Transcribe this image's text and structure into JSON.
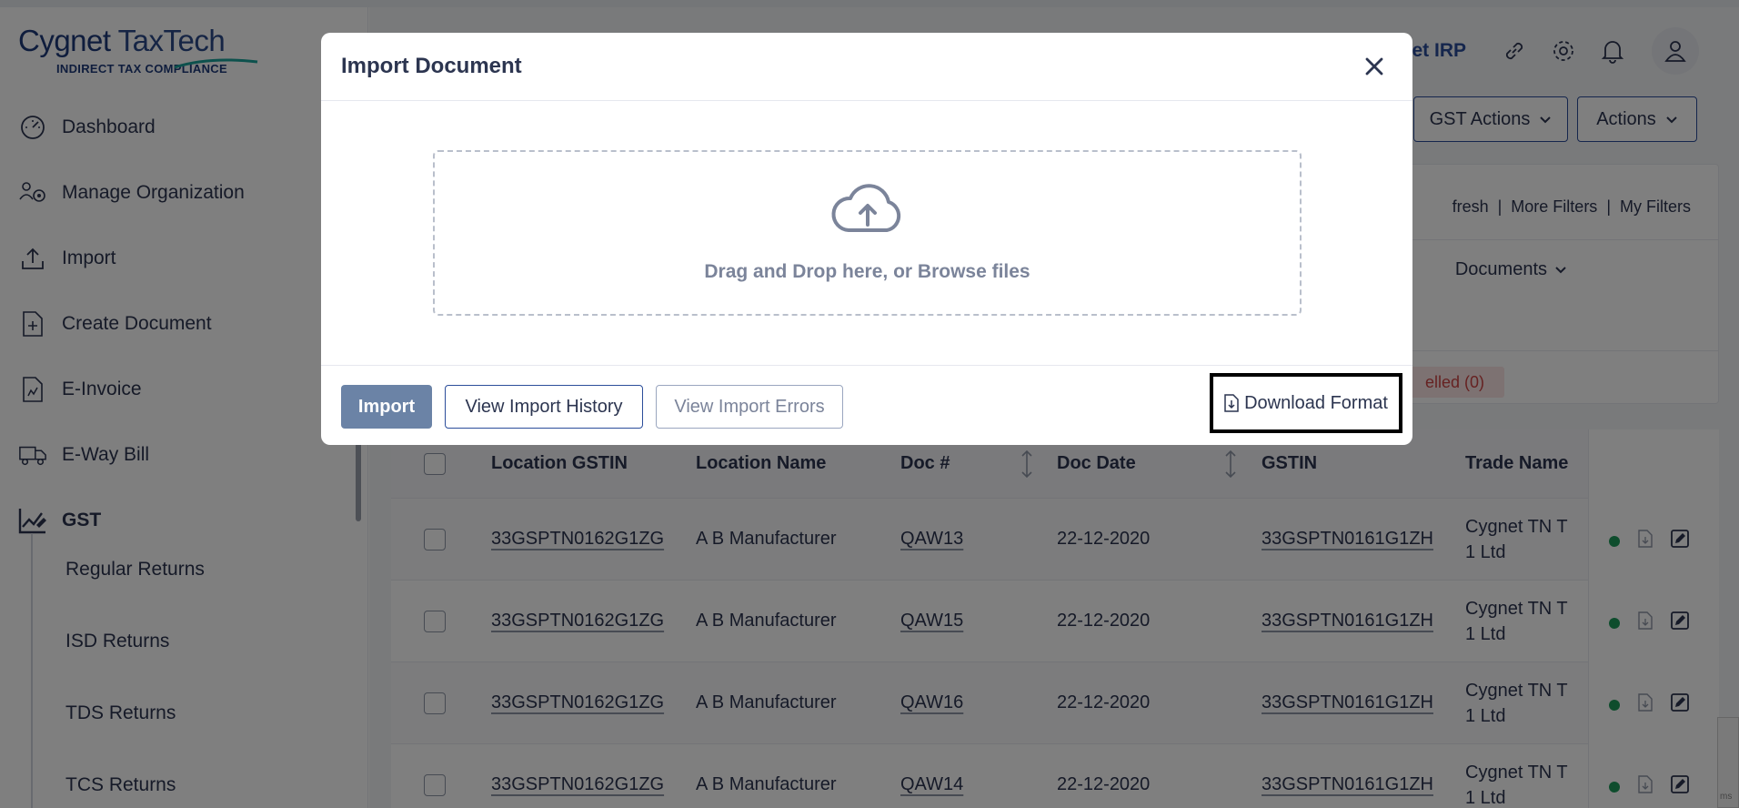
{
  "brand": {
    "logo_main": "Cygnet",
    "logo_tech": "TaxTech",
    "logo_sub": "INDIRECT TAX COMPLIANCE"
  },
  "sidebar": {
    "items": [
      {
        "label": "Dashboard",
        "icon": "gauge-icon"
      },
      {
        "label": "Manage Organization",
        "icon": "organization-icon"
      },
      {
        "label": "Import",
        "icon": "upload-icon"
      },
      {
        "label": "Create Document",
        "icon": "add-document-icon"
      },
      {
        "label": "E-Invoice",
        "icon": "invoice-icon"
      },
      {
        "label": "E-Way Bill",
        "icon": "truck-icon"
      },
      {
        "label": "GST",
        "icon": "chart-pen-icon"
      }
    ],
    "subitems": [
      "Regular Returns",
      "ISD Returns",
      "TDS Returns",
      "TCS Returns"
    ]
  },
  "header": {
    "irp_text": "net IRP"
  },
  "toolbar": {
    "gst_actions": "GST Actions",
    "actions": "Actions"
  },
  "filters": {
    "refresh": "fresh",
    "more_filters": "More Filters",
    "my_filters": "My Filters",
    "documents": "Documents",
    "cancelled": "elled (0)"
  },
  "table": {
    "headers": {
      "location_gstin": "Location GSTIN",
      "location_name": "Location Name",
      "doc_no": "Doc #",
      "doc_date": "Doc Date",
      "gstin": "GSTIN",
      "trade_name": "Trade Name"
    },
    "rows": [
      {
        "location_gstin": "33GSPTN0162G1ZG",
        "location_name": "A B Manufacturer",
        "doc_no": "QAW13",
        "doc_date": "22-12-2020",
        "gstin": "33GSPTN0161G1ZH",
        "trade_line1": "Cygnet TN T",
        "trade_line2": "1 Ltd"
      },
      {
        "location_gstin": "33GSPTN0162G1ZG",
        "location_name": "A B Manufacturer",
        "doc_no": "QAW15",
        "doc_date": "22-12-2020",
        "gstin": "33GSPTN0161G1ZH",
        "trade_line1": "Cygnet TN T",
        "trade_line2": "1 Ltd"
      },
      {
        "location_gstin": "33GSPTN0162G1ZG",
        "location_name": "A B Manufacturer",
        "doc_no": "QAW16",
        "doc_date": "22-12-2020",
        "gstin": "33GSPTN0161G1ZH",
        "trade_line1": "Cygnet TN T",
        "trade_line2": "1 Ltd"
      },
      {
        "location_gstin": "33GSPTN0162G1ZG",
        "location_name": "A B Manufacturer",
        "doc_no": "QAW14",
        "doc_date": "22-12-2020",
        "gstin": "33GSPTN0161G1ZH",
        "trade_line1": "Cygnet TN T",
        "trade_line2": "1 Ltd"
      }
    ]
  },
  "modal": {
    "title": "Import Document",
    "drop_text": "Drag and Drop here, or Browse files",
    "import_label": "Import",
    "history_label": "View Import History",
    "errors_label": "View Import Errors",
    "download_label": "Download Format"
  },
  "corner_widget": {
    "text": "ms"
  },
  "colors": {
    "brand_blue": "#2b4d9a",
    "primary_button": "#6b83a6",
    "status_green": "#1c9a5a",
    "overlay": "rgba(0,0,0,0.5)"
  }
}
